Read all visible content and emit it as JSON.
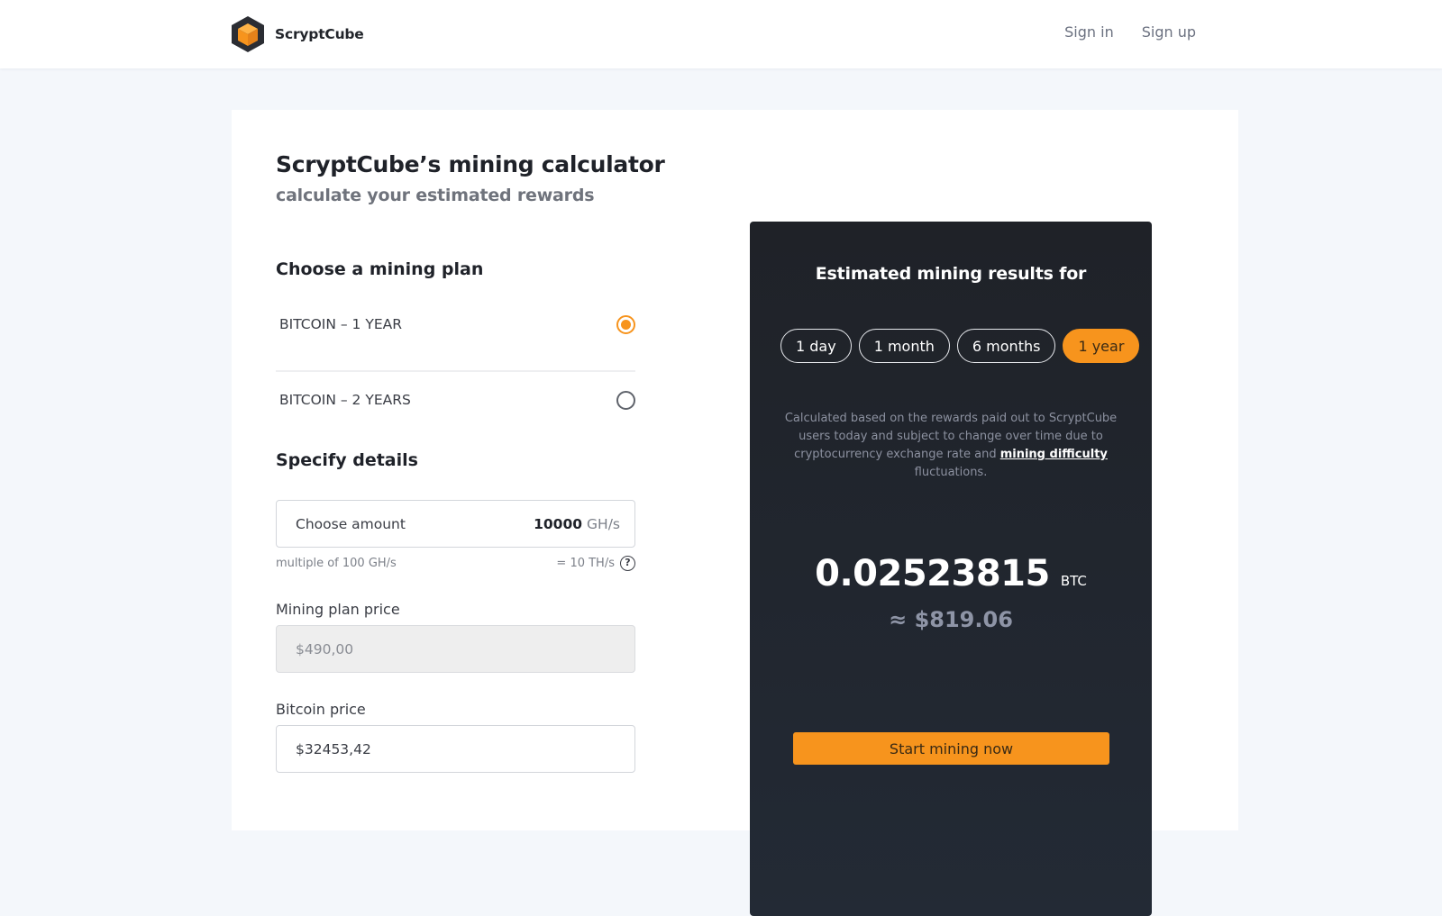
{
  "header": {
    "brand_name": "ScryptCube",
    "logo_icon": "hexagon-cube-icon",
    "nav": [
      {
        "label": "Sign in"
      },
      {
        "label": "Sign up"
      }
    ]
  },
  "calculator": {
    "title": "ScryptCube’s mining calculator",
    "subtitle": "calculate your estimated rewards",
    "plan_section_title": "Choose a mining plan",
    "plans": [
      {
        "label": "BITCOIN – 1 YEAR",
        "selected": true
      },
      {
        "label": "BITCOIN – 2 YEARS",
        "selected": false
      }
    ],
    "details_section_title": "Specify details",
    "amount": {
      "label": "Choose amount",
      "value": "10000",
      "unit": "GH/s",
      "hint_left": "multiple of 100 GH/s",
      "hint_right": "= 10 TH/s",
      "help_icon": "?"
    },
    "plan_price": {
      "label": "Mining plan price",
      "value": "$490,00"
    },
    "bitcoin_price": {
      "label": "Bitcoin price",
      "value": "$32453,42"
    }
  },
  "results": {
    "title": "Estimated mining results for",
    "periods": [
      {
        "label": "1 day",
        "active": false
      },
      {
        "label": "1 month",
        "active": false
      },
      {
        "label": "6 months",
        "active": false
      },
      {
        "label": "1 year",
        "active": true
      }
    ],
    "disclaimer_before": "Calculated based on the rewards paid out to ScryptCube users today and subject to change over time due to cryptocurrency exchange rate and ",
    "disclaimer_link": "mining difficulty",
    "disclaimer_after": " fluctuations.",
    "btc_value": "0.02523815",
    "btc_unit": "BTC",
    "usd_value": "≈ $819.06",
    "cta_label": "Start mining now"
  },
  "colors": {
    "accent": "#f7941d",
    "dark_panel": "#21242b",
    "page_bg": "#f4f7fb"
  }
}
